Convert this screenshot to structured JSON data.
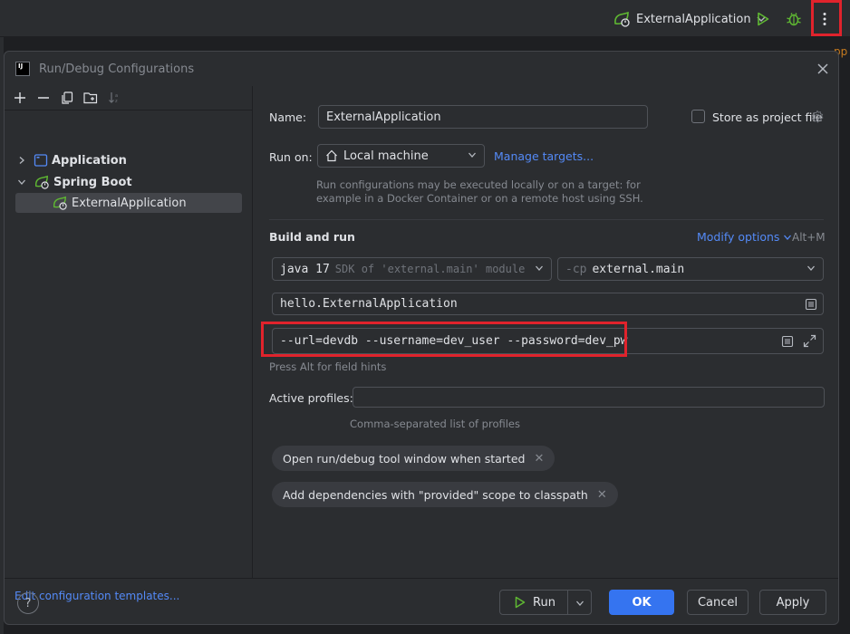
{
  "toolbar": {
    "run_config_name": "ExternalApplication"
  },
  "background": {
    "right_fragment": "pp"
  },
  "dialog": {
    "title": "Run/Debug Configurations",
    "tree": {
      "application": "Application",
      "spring_boot": "Spring Boot",
      "external_application": "ExternalApplication"
    },
    "edit_templates_link": "Edit configuration templates..."
  },
  "form": {
    "name_label": "Name:",
    "name_value": "ExternalApplication",
    "store_label": "Store as project file",
    "run_on_label": "Run on:",
    "run_on_value": "Local machine",
    "manage_targets": "Manage targets...",
    "run_on_hint_line1": "Run configurations may be executed locally or on a target: for",
    "run_on_hint_line2": "example in a Docker Container or on a remote host using SSH.",
    "build_run_title": "Build and run",
    "modify_options": "Modify options",
    "modify_shortcut": "Alt+M",
    "jdk_version": "java 17",
    "jdk_hint": "SDK of 'external.main' module",
    "cp_prefix": "-cp",
    "cp_value": "external.main",
    "main_class": "hello.ExternalApplication",
    "program_args": "--url=devdb --username=dev_user --password=dev_pw",
    "field_hints": "Press Alt for field hints",
    "active_profiles_label": "Active profiles:",
    "active_profiles_value": "",
    "active_profiles_hint": "Comma-separated list of profiles",
    "option_pill_1": "Open run/debug tool window when started",
    "option_pill_2": "Add dependencies with \"provided\" scope to classpath"
  },
  "footer": {
    "help": "?",
    "run_label": "Run",
    "ok_label": "OK",
    "cancel_label": "Cancel",
    "apply_label": "Apply"
  },
  "colors": {
    "accent": "#3574f0",
    "link": "#548af7",
    "highlight": "#e0232c",
    "spring_green": "#5fb832"
  }
}
